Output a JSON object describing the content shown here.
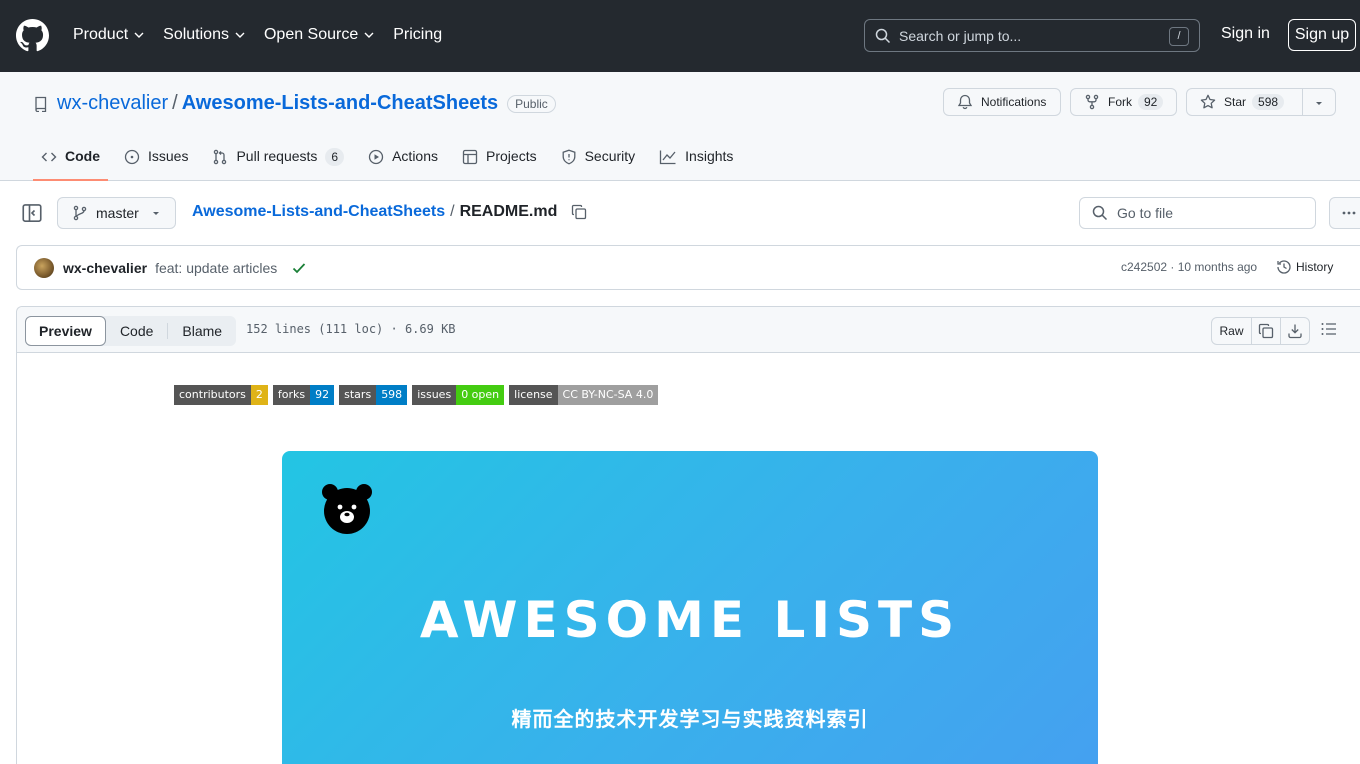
{
  "header": {
    "nav": [
      {
        "label": "Product",
        "dropdown": true
      },
      {
        "label": "Solutions",
        "dropdown": true
      },
      {
        "label": "Open Source",
        "dropdown": true
      },
      {
        "label": "Pricing",
        "dropdown": false
      }
    ],
    "search_placeholder": "Search or jump to...",
    "search_shortcut": "/",
    "sign_in": "Sign in",
    "sign_up": "Sign up"
  },
  "repo": {
    "owner": "wx-chevalier",
    "separator": "/",
    "name": "Awesome-Lists-and-CheatSheets",
    "visibility": "Public",
    "notifications_label": "Notifications",
    "fork_label": "Fork",
    "fork_count": "92",
    "star_label": "Star",
    "star_count": "598"
  },
  "tabs": [
    {
      "label": "Code",
      "icon": "code-icon",
      "active": true
    },
    {
      "label": "Issues",
      "icon": "issue-icon"
    },
    {
      "label": "Pull requests",
      "icon": "pull-request-icon",
      "count": "6"
    },
    {
      "label": "Actions",
      "icon": "play-icon"
    },
    {
      "label": "Projects",
      "icon": "table-icon"
    },
    {
      "label": "Security",
      "icon": "shield-icon"
    },
    {
      "label": "Insights",
      "icon": "graph-icon"
    }
  ],
  "file_nav": {
    "branch": "master",
    "crumb_repo": "Awesome-Lists-and-CheatSheets",
    "crumb_sep": "/",
    "crumb_file": "README.md",
    "goto_placeholder": "Go to file"
  },
  "commit": {
    "author": "wx-chevalier",
    "message": "feat: update articles",
    "meta": "c242502 · 10 months ago",
    "history_label": "History"
  },
  "viewer": {
    "modes": [
      "Preview",
      "Code",
      "Blame"
    ],
    "active_mode": "Preview",
    "info": "152 lines (111 loc) · 6.69 KB",
    "raw_label": "Raw"
  },
  "readme": {
    "badges": [
      {
        "key": "contributors",
        "value": "2",
        "color": "#dfb317"
      },
      {
        "key": "forks",
        "value": "92",
        "color": "#007ec6"
      },
      {
        "key": "stars",
        "value": "598",
        "color": "#007ec6"
      },
      {
        "key": "issues",
        "value": "0 open",
        "color": "#4c1"
      },
      {
        "key": "license",
        "value": "CC BY-NC-SA 4.0",
        "color": "#9f9f9f"
      }
    ],
    "banner_title": "AWESOME LISTS",
    "banner_subtitle": "精而全的技术开发学习与实践资料索引"
  },
  "colors": {
    "header_bg": "#24292f",
    "link": "#0969da",
    "active_tab_underline": "#fd8c73",
    "success": "#1a7f37"
  }
}
